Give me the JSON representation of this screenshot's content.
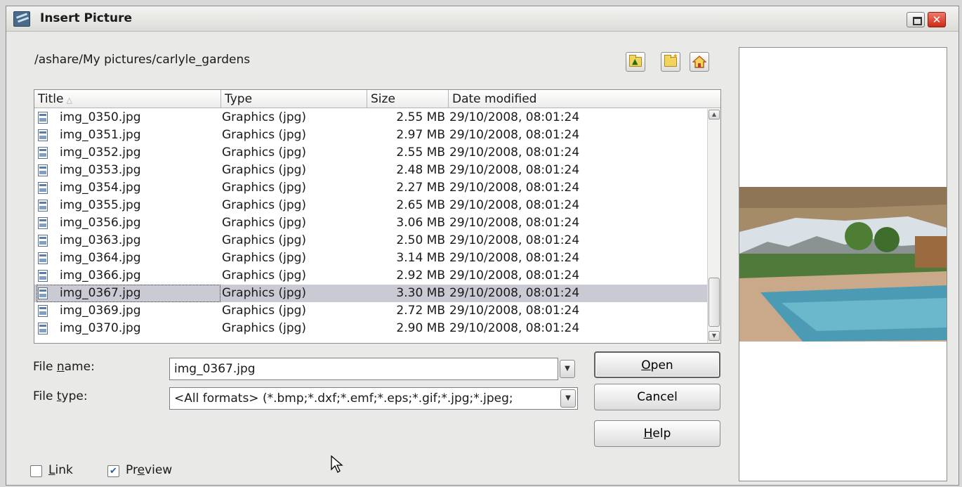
{
  "window": {
    "title": "Insert Picture",
    "close_glyph": "✕"
  },
  "path": "/ashare/My pictures/carlyle_gardens",
  "toolbar": {
    "icons": [
      "folder-up-icon",
      "new-folder-icon",
      "home-icon"
    ]
  },
  "file_list": {
    "columns": [
      "Title",
      "Type",
      "Size",
      "Date modified"
    ],
    "sort_indicator": "△",
    "rows": [
      {
        "title": "img_0350.jpg",
        "type": "Graphics (jpg)",
        "size": "2.55 MB",
        "date": "29/10/2008, 08:01:24"
      },
      {
        "title": "img_0351.jpg",
        "type": "Graphics (jpg)",
        "size": "2.97 MB",
        "date": "29/10/2008, 08:01:24"
      },
      {
        "title": "img_0352.jpg",
        "type": "Graphics (jpg)",
        "size": "2.55 MB",
        "date": "29/10/2008, 08:01:24"
      },
      {
        "title": "img_0353.jpg",
        "type": "Graphics (jpg)",
        "size": "2.48 MB",
        "date": "29/10/2008, 08:01:24"
      },
      {
        "title": "img_0354.jpg",
        "type": "Graphics (jpg)",
        "size": "2.27 MB",
        "date": "29/10/2008, 08:01:24"
      },
      {
        "title": "img_0355.jpg",
        "type": "Graphics (jpg)",
        "size": "2.65 MB",
        "date": "29/10/2008, 08:01:24"
      },
      {
        "title": "img_0356.jpg",
        "type": "Graphics (jpg)",
        "size": "3.06 MB",
        "date": "29/10/2008, 08:01:24"
      },
      {
        "title": "img_0363.jpg",
        "type": "Graphics (jpg)",
        "size": "2.50 MB",
        "date": "29/10/2008, 08:01:24"
      },
      {
        "title": "img_0364.jpg",
        "type": "Graphics (jpg)",
        "size": "3.14 MB",
        "date": "29/10/2008, 08:01:24"
      },
      {
        "title": "img_0366.jpg",
        "type": "Graphics (jpg)",
        "size": "2.92 MB",
        "date": "29/10/2008, 08:01:24"
      },
      {
        "title": "img_0367.jpg",
        "type": "Graphics (jpg)",
        "size": "3.30 MB",
        "date": "29/10/2008, 08:01:24",
        "selected": true
      },
      {
        "title": "img_0369.jpg",
        "type": "Graphics (jpg)",
        "size": "2.72 MB",
        "date": "29/10/2008, 08:01:24"
      },
      {
        "title": "img_0370.jpg",
        "type": "Graphics (jpg)",
        "size": "2.90 MB",
        "date": "29/10/2008, 08:01:24"
      }
    ]
  },
  "file_name": {
    "label_pre": "File ",
    "label_mnemonic": "n",
    "label_post": "ame:",
    "value": "img_0367.jpg"
  },
  "file_type": {
    "label_pre": "File ",
    "label_mnemonic": "t",
    "label_post": "ype:",
    "value": "<All formats> (*.bmp;*.dxf;*.emf;*.eps;*.gif;*.jpg;*.jpeg;"
  },
  "buttons": {
    "open": {
      "mnemonic": "O",
      "rest": "pen"
    },
    "cancel": "Cancel",
    "help": {
      "mnemonic": "H",
      "rest": "elp"
    }
  },
  "options": {
    "link": {
      "mnemonic": "L",
      "rest": "ink",
      "checked": false
    },
    "preview": {
      "pre": "Pr",
      "mnemonic": "e",
      "rest": "view",
      "checked": true,
      "check_glyph": "✔"
    }
  },
  "colors": {
    "selection": "#cacad4",
    "close_button": "#cc2a12"
  }
}
